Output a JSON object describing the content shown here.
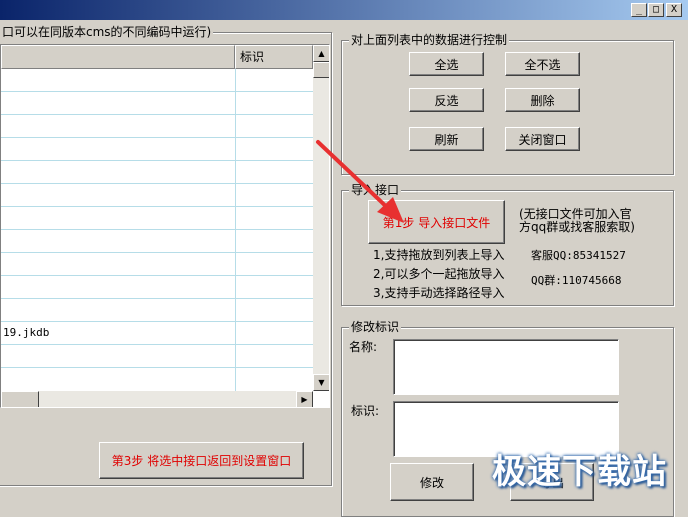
{
  "window": {
    "controls": {
      "minimize": "_",
      "maximize": "□",
      "close": "X"
    }
  },
  "left_panel": {
    "group_label": "口可以在同版本cms的不同编码中运行)",
    "list": {
      "columns": [
        "",
        "标识"
      ],
      "rows": [
        {
          "name": "",
          "id": ""
        },
        {
          "name": "",
          "id": ""
        },
        {
          "name": "",
          "id": ""
        },
        {
          "name": "",
          "id": ""
        },
        {
          "name": "",
          "id": ""
        },
        {
          "name": "",
          "id": ""
        },
        {
          "name": "",
          "id": ""
        },
        {
          "name": "",
          "id": ""
        },
        {
          "name": "",
          "id": ""
        },
        {
          "name": "",
          "id": ""
        },
        {
          "name": "",
          "id": ""
        },
        {
          "name": "19.jkdb",
          "id": ""
        },
        {
          "name": "",
          "id": ""
        }
      ]
    },
    "step3_button": "第3步 将选中接口返回到设置窗口"
  },
  "control_group": {
    "label": "对上面列表中的数据进行控制",
    "buttons": {
      "select_all": "全选",
      "select_none": "全不选",
      "invert": "反选",
      "delete": "删除",
      "refresh": "刷新",
      "close_window": "关闭窗口"
    }
  },
  "import_group": {
    "label": "导入接口",
    "step1_button": "第1步 导入接口文件",
    "notice_line1": "(无接口文件可加入官",
    "notice_line2": "方qq群或找客服索取)",
    "support_lines": [
      "1,支持拖放到列表上导入",
      "2,可以多个一起拖放导入",
      "3,支持手动选择路径导入"
    ],
    "service_qq": "客服QQ:85341527",
    "qq_group": "QQ群:110745668"
  },
  "edit_group": {
    "label": "修改标识",
    "name_label": "名称:",
    "id_label": "标识:",
    "name_value": "",
    "id_value": "",
    "modify_button": "修改",
    "export_button": "导出"
  },
  "watermark": "极速下载站",
  "colors": {
    "title_start": "#0a246a",
    "title_end": "#a6caf0",
    "accent_red": "#e00000",
    "grid_line": "#b6dde8"
  }
}
